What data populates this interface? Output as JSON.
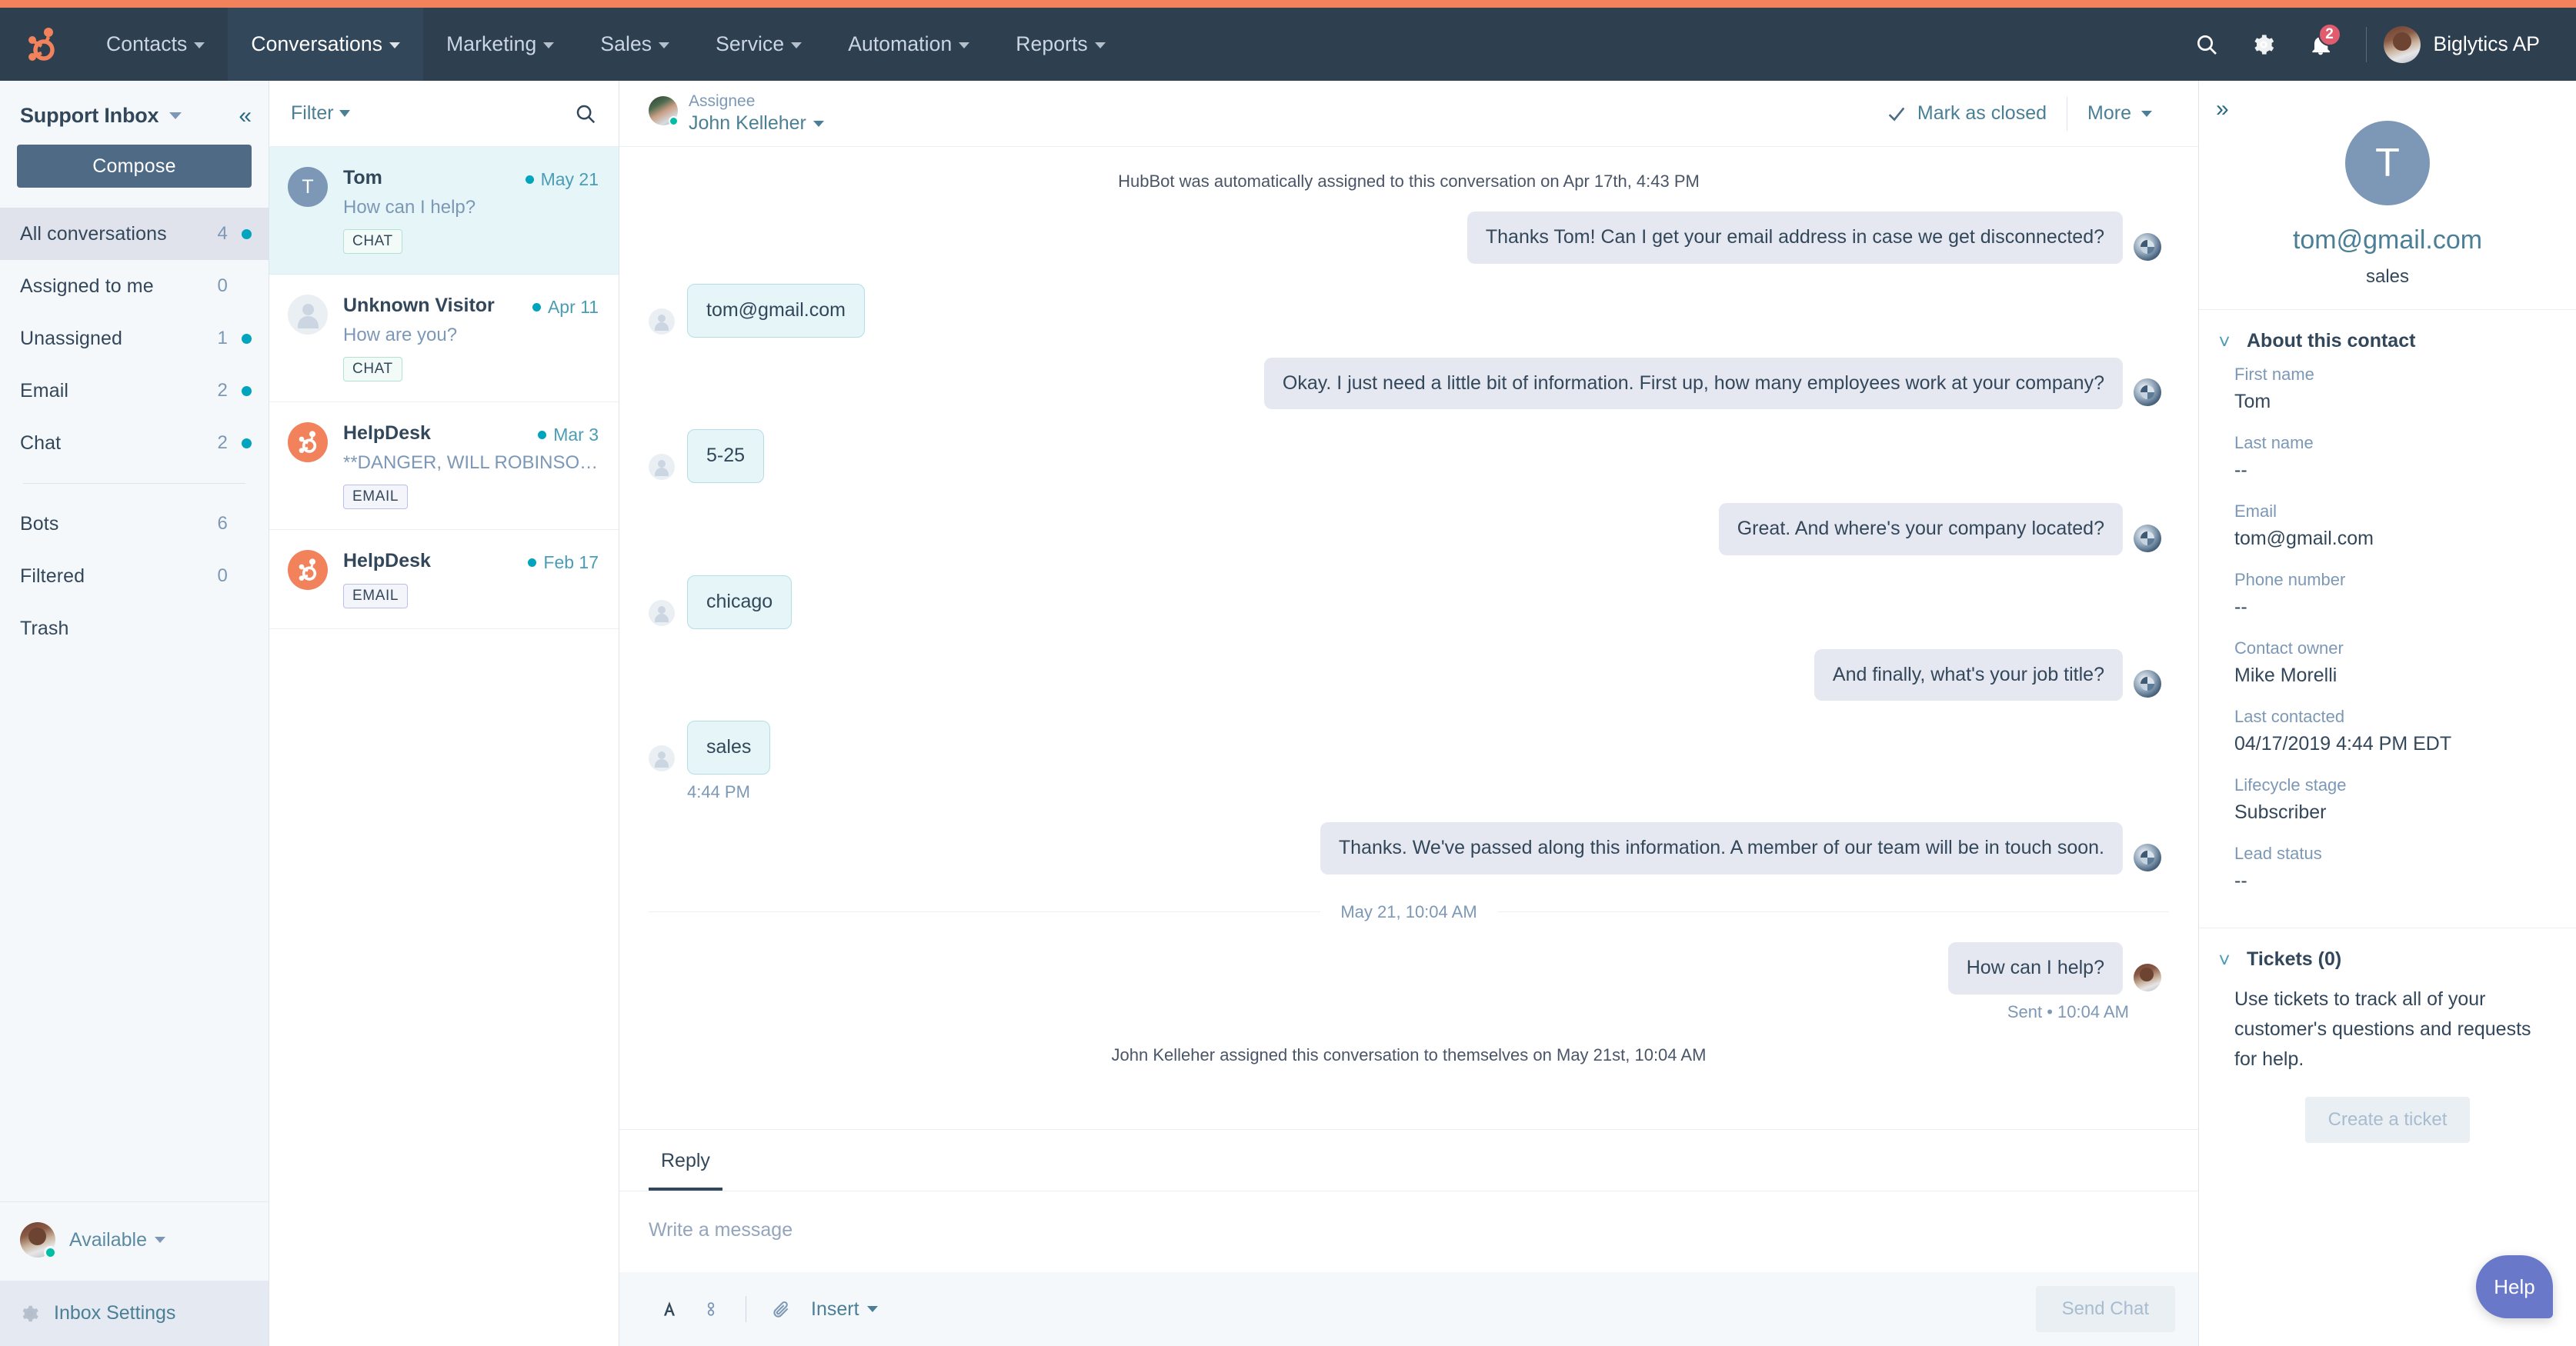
{
  "colors": {
    "brand_orange": "#f2825b",
    "nav_bg": "#2e3f50",
    "nav_active": "#33475b",
    "accent_teal": "#00a4bd",
    "link_blue": "#4a7f96",
    "help_purple": "#6a78c9"
  },
  "globalnav": {
    "logo_icon": "hubspot-sprocket-logo",
    "items": [
      {
        "label": "Contacts",
        "active": false
      },
      {
        "label": "Conversations",
        "active": true
      },
      {
        "label": "Marketing",
        "active": false
      },
      {
        "label": "Sales",
        "active": false
      },
      {
        "label": "Service",
        "active": false
      },
      {
        "label": "Automation",
        "active": false
      },
      {
        "label": "Reports",
        "active": false
      }
    ],
    "search_icon": "search-icon",
    "settings_icon": "gear-icon",
    "notifications_icon": "bell-icon",
    "notifications_count": "2",
    "account_name": "Biglytics AP"
  },
  "sidebar": {
    "title": "Support Inbox",
    "compose_label": "Compose",
    "items": [
      {
        "label": "All conversations",
        "count": "4",
        "unread": true,
        "active": true
      },
      {
        "label": "Assigned to me",
        "count": "0",
        "unread": false,
        "active": false
      },
      {
        "label": "Unassigned",
        "count": "1",
        "unread": true,
        "active": false
      },
      {
        "label": "Email",
        "count": "2",
        "unread": true,
        "active": false
      },
      {
        "label": "Chat",
        "count": "2",
        "unread": true,
        "active": false
      }
    ],
    "items2": [
      {
        "label": "Bots",
        "count": "6",
        "unread": false,
        "active": false
      },
      {
        "label": "Filtered",
        "count": "0",
        "unread": false,
        "active": false
      },
      {
        "label": "Trash",
        "count": "",
        "unread": false,
        "active": false
      }
    ],
    "availability_label": "Available",
    "settings_label": "Inbox Settings"
  },
  "conversation_list": {
    "filter_label": "Filter",
    "search_icon": "search-icon",
    "items": [
      {
        "avatar_type": "initial",
        "avatar_text": "T",
        "name": "Tom",
        "date": "May 21",
        "unread": true,
        "preview": "How can I help?",
        "tag": "CHAT",
        "tag_type": "chat",
        "selected": true
      },
      {
        "avatar_type": "anon",
        "avatar_text": "",
        "name": "Unknown Visitor",
        "date": "Apr 11",
        "unread": true,
        "preview": "How are you?",
        "tag": "CHAT",
        "tag_type": "chat",
        "selected": false
      },
      {
        "avatar_type": "hub",
        "avatar_text": "",
        "name": "HelpDesk",
        "date": "Mar 3",
        "unread": true,
        "preview": "**DANGER, WILL ROBINSON!** ...",
        "tag": "EMAIL",
        "tag_type": "email",
        "selected": false
      },
      {
        "avatar_type": "hub",
        "avatar_text": "",
        "name": "HelpDesk",
        "date": "Feb 17",
        "unread": true,
        "preview": "",
        "tag": "EMAIL",
        "tag_type": "email",
        "selected": false
      }
    ]
  },
  "thread": {
    "assignee_label": "Assignee",
    "assignee_name": "John Kelleher",
    "mark_closed_label": "Mark as closed",
    "more_label": "More",
    "expand_icon": "chevron-double-right-icon",
    "system_note_top": "HubBot was automatically assigned to this conversation on Apr 17th, 4:43 PM",
    "messages": [
      {
        "side": "out",
        "text": "Thanks Tom! Can I get your email address in case we get disconnected?",
        "avatar": "bot"
      },
      {
        "side": "in",
        "text": "tom@gmail.com",
        "avatar": "visitor"
      },
      {
        "side": "out",
        "text": "Okay. I just need a little bit of information. First up, how many employees work at your company?",
        "avatar": "bot"
      },
      {
        "side": "in",
        "text": "5-25",
        "avatar": "visitor"
      },
      {
        "side": "out",
        "text": "Great. And where's your company located?",
        "avatar": "bot"
      },
      {
        "side": "in",
        "text": "chicago",
        "avatar": "visitor"
      },
      {
        "side": "out",
        "text": "And finally, what's your job title?",
        "avatar": "bot"
      },
      {
        "side": "in",
        "text": "sales",
        "avatar": "visitor",
        "timestamp": "4:44 PM"
      },
      {
        "side": "out",
        "text": "Thanks. We've passed along this information. A member of our team will be in touch soon.",
        "avatar": "bot"
      }
    ],
    "date_divider": "May 21, 10:04 AM",
    "agent_message": {
      "text": "How can I help?",
      "status": "Sent • 10:04 AM"
    },
    "system_note_bottom": "John Kelleher assigned this conversation to themselves on May 21st, 10:04 AM",
    "editor": {
      "tab_label": "Reply",
      "placeholder": "Write a message",
      "font_icon": "font-color-icon",
      "link_icon": "link-icon",
      "attach_icon": "paperclip-icon",
      "insert_label": "Insert",
      "send_label": "Send Chat"
    }
  },
  "contact": {
    "expand_icon": "chevron-double-right-icon",
    "avatar_initial": "T",
    "email": "tom@gmail.com",
    "subtitle": "sales",
    "about_section_title": "About this contact",
    "fields": [
      {
        "label": "First name",
        "value": "Tom"
      },
      {
        "label": "Last name",
        "value": "--"
      },
      {
        "label": "Email",
        "value": "tom@gmail.com"
      },
      {
        "label": "Phone number",
        "value": "--"
      },
      {
        "label": "Contact owner",
        "value": "Mike Morelli"
      },
      {
        "label": "Last contacted",
        "value": "04/17/2019 4:44 PM EDT"
      },
      {
        "label": "Lifecycle stage",
        "value": "Subscriber"
      },
      {
        "label": "Lead status",
        "value": "--"
      }
    ],
    "tickets_title": "Tickets (0)",
    "tickets_copy": "Use tickets to track all of your customer's questions and requests for help.",
    "create_ticket_label": "Create a ticket",
    "help_label": "Help"
  }
}
